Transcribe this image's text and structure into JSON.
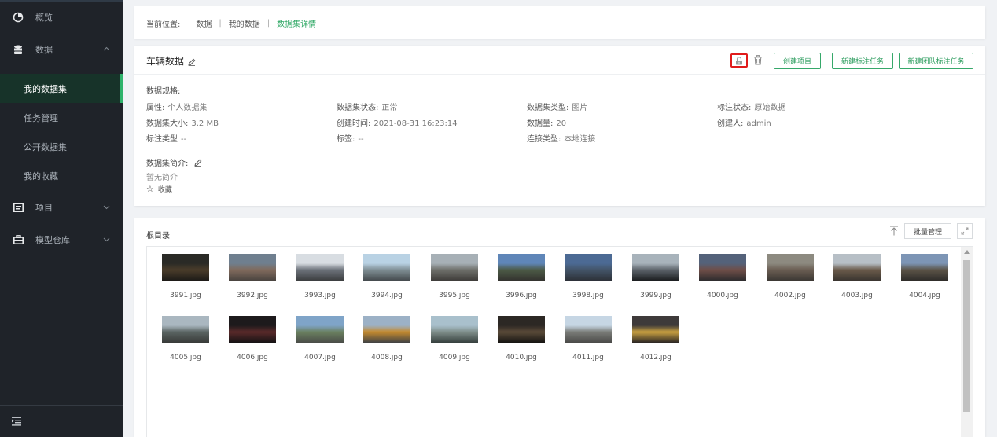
{
  "sidebar": {
    "overview": "概览",
    "data": "数据",
    "my_datasets": "我的数据集",
    "task_management": "任务管理",
    "public_datasets": "公开数据集",
    "my_favorites": "我的收藏",
    "projects": "项目",
    "model_warehouse": "模型仓库"
  },
  "breadcrumb": {
    "prefix": "当前位置:",
    "items": [
      "数据",
      "我的数据",
      "数据集详情"
    ],
    "current_color": "#2fa865"
  },
  "detail": {
    "title": "车辆数据",
    "buttons": {
      "create_project": "创建项目",
      "new_annotation_task": "新建标注任务",
      "new_team_annotation_task": "新建团队标注任务"
    },
    "spec_label": "数据规格:",
    "meta": {
      "attribute_k": "属性:",
      "attribute_v": "个人数据集",
      "status_k": "数据集状态:",
      "status_v": "正常",
      "type_k": "数据集类型:",
      "type_v": "图片",
      "annot_status_k": "标注状态:",
      "annot_status_v": "原始数据",
      "size_k": "数据集大小:",
      "size_v": "3.2 MB",
      "created_k": "创建时间:",
      "created_v": "2021-08-31 16:23:14",
      "count_k": "数据量:",
      "count_v": "20",
      "creator_k": "创建人:",
      "creator_v": "admin",
      "annot_type_k": "标注类型",
      "annot_type_v": "--",
      "tags_k": "标签:",
      "tags_v": "--",
      "conn_type_k": "连接类型:",
      "conn_type_v": "本地连接"
    },
    "intro_label": "数据集简介:",
    "intro_text": "暂无简介",
    "favorite": "收藏",
    "accent_color": "#36a86a",
    "highlight_color": "#e01b1b"
  },
  "files": {
    "title": "根目录",
    "batch_manage": "批量管理",
    "items": [
      "3991.jpg",
      "3992.jpg",
      "3993.jpg",
      "3994.jpg",
      "3995.jpg",
      "3996.jpg",
      "3998.jpg",
      "3999.jpg",
      "4000.jpg",
      "4002.jpg",
      "4003.jpg",
      "4004.jpg",
      "4005.jpg",
      "4006.jpg",
      "4007.jpg",
      "4008.jpg",
      "4009.jpg",
      "4010.jpg",
      "4011.jpg",
      "4012.jpg"
    ]
  }
}
